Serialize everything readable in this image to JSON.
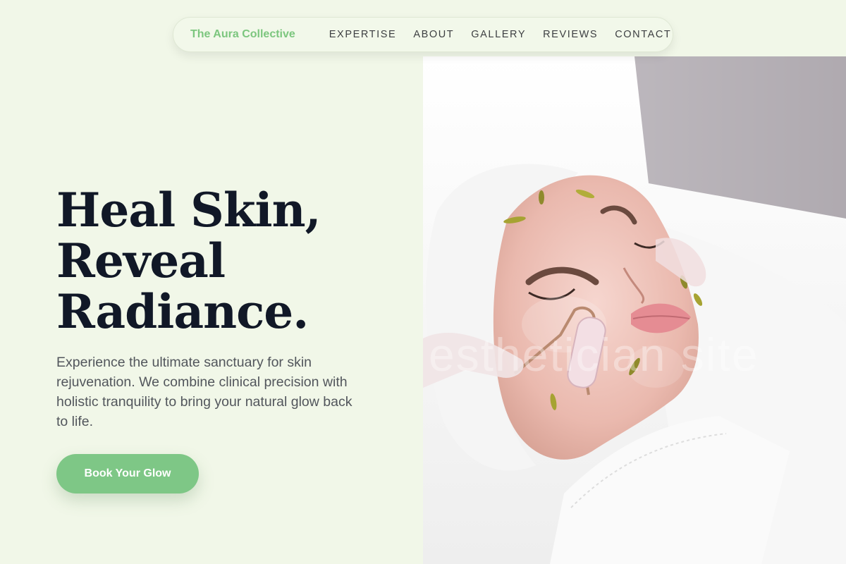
{
  "nav": {
    "brand": "The Aura Collective",
    "links": [
      "EXPERTISE",
      "ABOUT",
      "GALLERY",
      "REVIEWS",
      "CONTACT"
    ]
  },
  "hero": {
    "title_lines": [
      "Heal Skin,",
      "Reveal",
      "Radiance."
    ],
    "description": "Experience the ultimate sanctuary for skin rejuvenation. We combine clinical precision with holistic tranquility to bring your natural glow back to life.",
    "cta_label": "Book Your Glow",
    "image_watermark": "esthetician site"
  },
  "colors": {
    "background": "#f1f7e8",
    "brand": "#7cc67e",
    "cta": "#7ec786",
    "heading": "#111827",
    "body_text": "#52565c"
  }
}
